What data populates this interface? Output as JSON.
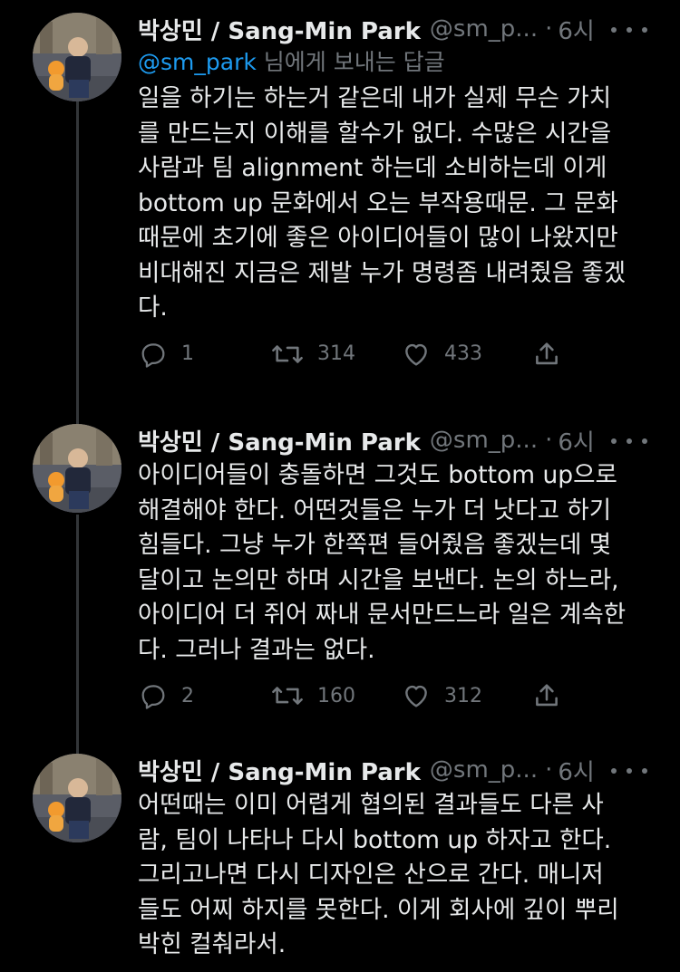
{
  "tweets": [
    {
      "name": "박상민 / Sang-Min Park",
      "handle": "@sm_p...",
      "separator": "·",
      "time": "6시",
      "reply_to": {
        "mention": "@sm_park",
        "suffix": " 님에게 보내는 답글"
      },
      "lines": [
        "일을 하기는 하는거 같은데 내가 실제 무슨 가치",
        "를 만드는지 이해를 할수가 없다. 수많은 시간을",
        "사람과 팀 alignment 하는데 소비하는데 이게",
        "bottom up 문화에서 오는 부작용때문. 그 문화",
        "때문에 초기에 좋은 아이디어들이 많이 나왔지만",
        "비대해진 지금은 제발 누가 명령좀 내려줬음 좋겠",
        "다."
      ],
      "replies": "1",
      "retweets": "314",
      "likes": "433"
    },
    {
      "name": "박상민 / Sang-Min Park",
      "handle": "@sm_p...",
      "separator": "·",
      "time": "6시",
      "lines": [
        "아이디어들이 충돌하면 그것도 bottom up으로",
        "해결해야 한다. 어떤것들은 누가 더 낫다고 하기",
        "힘들다. 그냥 누가 한쪽편 들어줬음 좋겠는데 몇",
        "달이고 논의만 하며 시간을 보낸다. 논의 하느라,",
        "아이디어 더 쥐어 짜내 문서만드느라 일은 계속한",
        "다. 그러나 결과는 없다."
      ],
      "replies": "2",
      "retweets": "160",
      "likes": "312"
    },
    {
      "name": "박상민 / Sang-Min Park",
      "handle": "@sm_p...",
      "separator": "·",
      "time": "6시",
      "lines": [
        "어떤때는 이미 어렵게 협의된 결과들도 다른 사",
        "람, 팀이 나타나 다시 bottom up 하자고 한다.",
        "그리고나면 다시 디자인은 산으로 간다. 매니저",
        "들도 어찌 하지를 못한다. 이게 회사에 깊이 뿌리",
        "박힌 컬춰라서."
      ]
    }
  ],
  "colors": {
    "background": "#000000",
    "text": "#e7e9ea",
    "muted": "#71767b",
    "link": "#1d9bf0",
    "thread_line": "#333639"
  },
  "icons": [
    "more-icon",
    "reply-icon",
    "retweet-icon",
    "like-icon",
    "share-icon"
  ]
}
